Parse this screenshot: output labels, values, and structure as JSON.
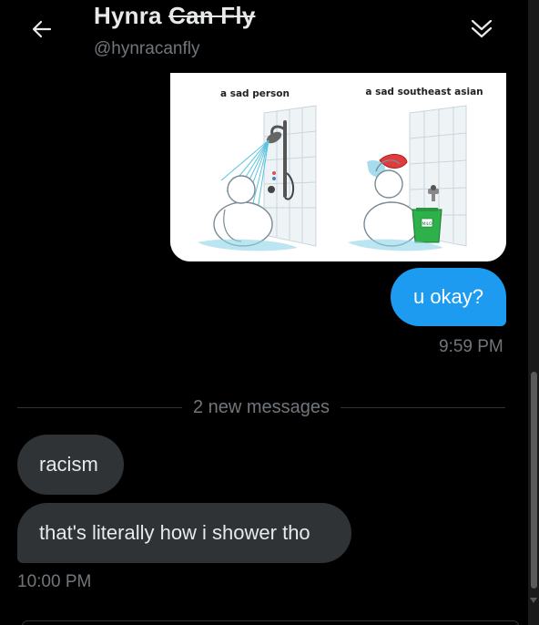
{
  "header": {
    "name_first": "Hynra",
    "name_struck": "Can Fly",
    "handle": "@hynracanfly",
    "back_icon": "arrow-left-icon",
    "collapse_icon": "chevrons-down-icon"
  },
  "image_message": {
    "left_caption": "a sad person",
    "right_caption": "a sad southeast asian",
    "bucket_label": "MILO"
  },
  "outgoing": {
    "text": "u okay?",
    "time": "9:59 PM"
  },
  "divider": {
    "text": "2 new messages"
  },
  "incoming": {
    "messages": [
      "racism",
      "that's literally how i shower tho"
    ],
    "time": "10:00 PM"
  },
  "colors": {
    "accent": "#1d9bf0",
    "bubble_in": "#2f3336",
    "muted": "#71767b",
    "background": "#000000"
  }
}
